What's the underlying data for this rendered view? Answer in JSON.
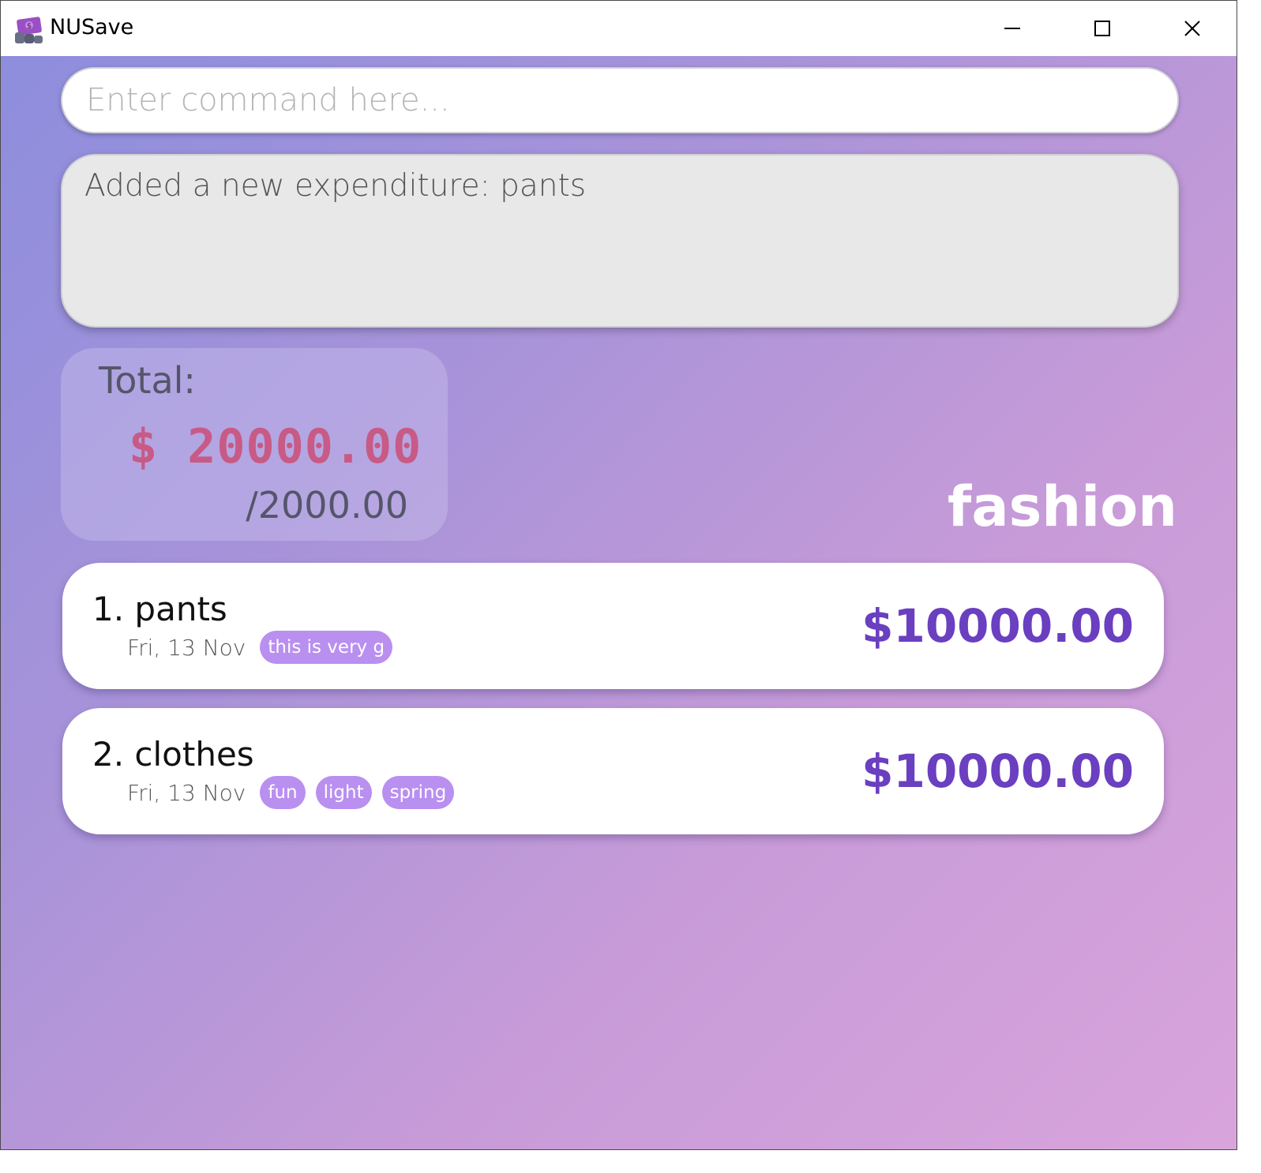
{
  "window": {
    "title": "NUSave"
  },
  "window_controls": {
    "minimize_icon": "minimize-icon",
    "maximize_icon": "maximize-icon",
    "close_icon": "close-icon"
  },
  "command": {
    "placeholder": "Enter command here...",
    "value": ""
  },
  "result": {
    "message": "Added a new expenditure: pants"
  },
  "summary": {
    "label": "Total:",
    "amount": "$ 20000.00",
    "budget": "/2000.00"
  },
  "category": "fashion",
  "expenditures": [
    {
      "title": "1. pants",
      "date": "Fri, 13 Nov",
      "tags": [
        "this is very g"
      ],
      "amount": "$10000.00"
    },
    {
      "title": "2. clothes",
      "date": "Fri, 13 Nov",
      "tags": [
        "fun",
        "light",
        "spring"
      ],
      "amount": "$10000.00"
    }
  ],
  "colors": {
    "gradient_start": "#8d8edd",
    "gradient_end": "#d9a4dc",
    "total_amount": "#c85a86",
    "expenditure_amount": "#6a3fc0",
    "tag_background": "#b98ff0"
  }
}
